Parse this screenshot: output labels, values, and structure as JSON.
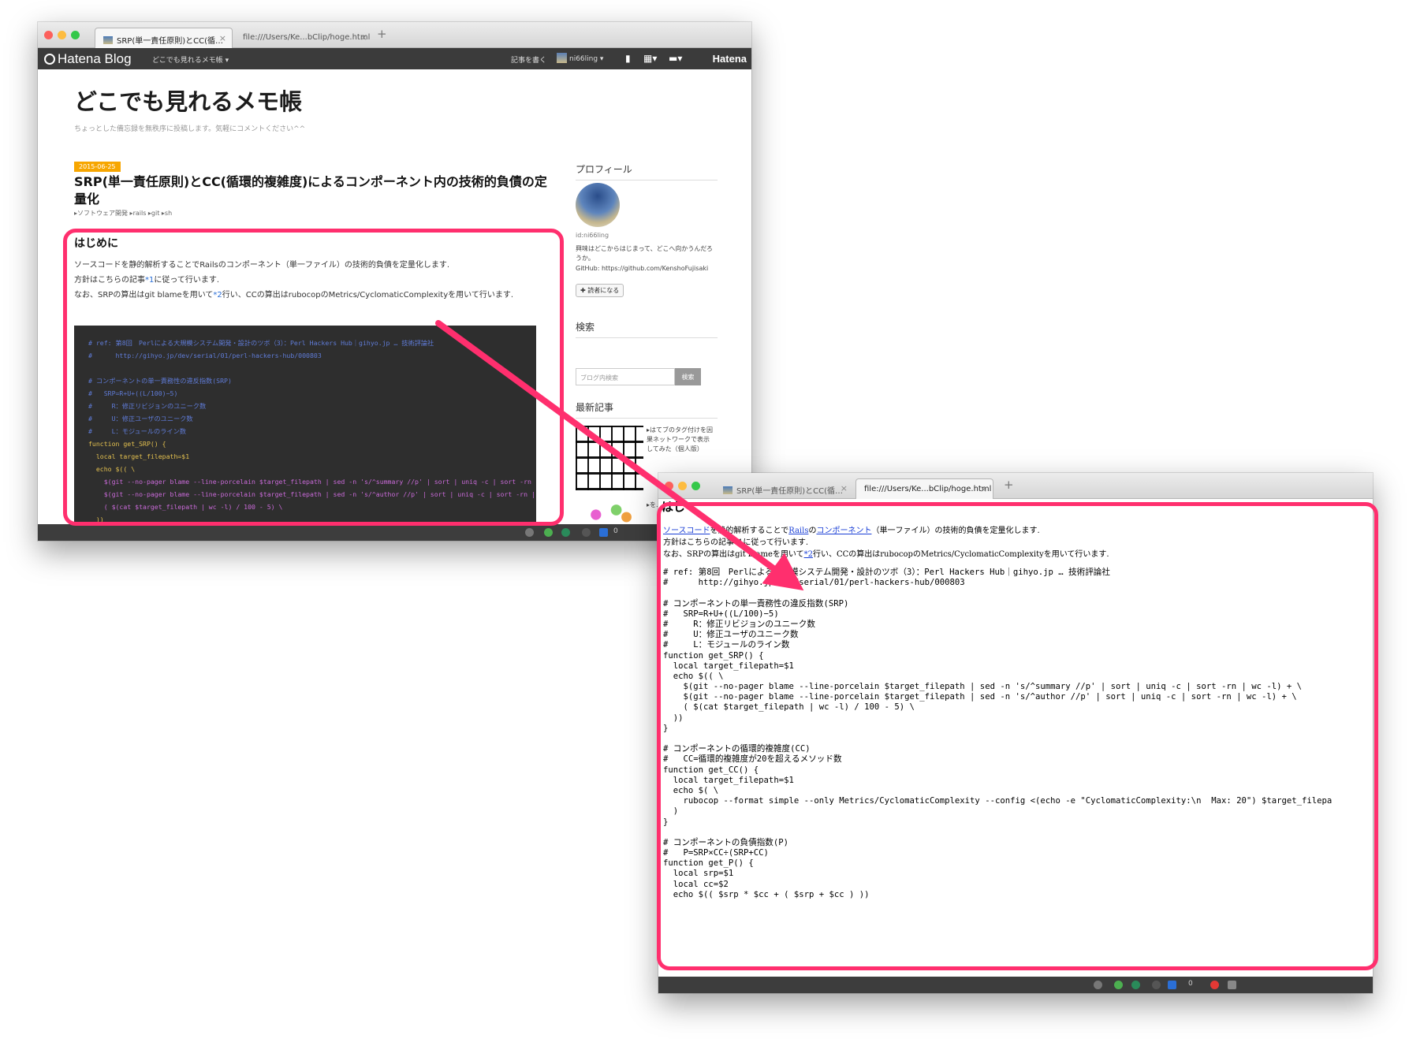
{
  "back_window": {
    "tabs": [
      {
        "label": "SRP(単一責任原則)とCC(循…",
        "active": true
      },
      {
        "label": "file:///Users/Ke...bClip/hoge.html",
        "active": false
      }
    ],
    "tab_close": "×",
    "new_tab": "+",
    "hatena_bar": {
      "logo": "Hatena Blog",
      "blog_menu": "どこでも見れるメモ帳 ▾",
      "write": "記事を書く",
      "user": "ni66ling ▾",
      "icons": [
        "bookmark-icon",
        "grid-icon",
        "comment-icon"
      ],
      "brand": "Hatena"
    },
    "blog": {
      "title": "どこでも見れるメモ帳",
      "description": "ちょっとした備忘録を無秩序に投稿します。気軽にコメントください^^",
      "date": "2015-06-25",
      "entry_title": "SRP(単一責任原則)とCC(循環的複雑度)によるコンポーネント内の技術的負債の定量化",
      "categories": "▸ソフトウェア開発 ▸rails ▸git ▸sh",
      "heading": "はじめに",
      "para1": "ソースコードを静的解析することでRailsのコンポーネント（単一ファイル）の技術的負債を定量化します.",
      "para2_a": "方針はこちらの記事",
      "para2_fn": "*1",
      "para2_b": "に従って行います.",
      "para3_a": "なお、SRPの算出はgit blameを用いて",
      "para3_fn": "*2",
      "para3_b": "行い、CCの算出はrubocopのMetrics/CyclomaticComplexityを用いて行います."
    },
    "code_lines": [
      {
        "cls": "cm",
        "text": "# ref: 第8回　Perlによる大規模システム開発・設計のツボ（3）：Perl Hackers Hub｜gihyo.jp … 技術評論社"
      },
      {
        "cls": "cm",
        "text": "#      http://gihyo.jp/dev/serial/01/perl-hackers-hub/000803"
      },
      {
        "cls": "bl",
        "text": ""
      },
      {
        "cls": "cm",
        "text": "# コンポーネントの単一責務性の違反指数(SRP)"
      },
      {
        "cls": "cm",
        "text": "#   SRP=R+U+((L/100)−5)"
      },
      {
        "cls": "cm",
        "text": "#     R：修正リビジョンのユニーク数"
      },
      {
        "cls": "cm",
        "text": "#     U：修正ユーザのユニーク数"
      },
      {
        "cls": "cm",
        "text": "#     L：モジュールのライン数"
      },
      {
        "cls": "kw",
        "text": "function get_SRP() {"
      },
      {
        "cls": "kw",
        "text": "  local target_filepath=$1"
      },
      {
        "cls": "kw",
        "text": "  echo $(( \\"
      },
      {
        "cls": "sh",
        "text": "    $(git --no-pager blame --line-porcelain $target_filepath | sed -n 's/^summary //p' | sort | uniq -c | sort -rn | wc -l) + \\"
      },
      {
        "cls": "sh",
        "text": "    $(git --no-pager blame --line-porcelain $target_filepath | sed -n 's/^author //p' | sort | uniq -c | sort -rn | wc -l) + \\"
      },
      {
        "cls": "sh",
        "text": "    ( $(cat $target_filepath | wc -l) / 100 - 5) \\"
      },
      {
        "cls": "kw",
        "text": "  ))"
      },
      {
        "cls": "kw",
        "text": "}"
      }
    ],
    "sidebar": {
      "profile_heading": "プロフィール",
      "id": "id:ni66ling",
      "bio": "興味はどこからはじまって、どこへ向かうんだろうか。",
      "github": "GitHub: https://github.com/KenshoFujisaki",
      "follow": "✚ 読者になる",
      "search_heading": "検索",
      "search_placeholder": "ブログ内検索",
      "search_button": "検索",
      "recent_heading": "最新記事",
      "recent": [
        "▸はてブのタグ付けを因果ネットワークで表示してみた（個人版）",
        "▸を...示..."
      ]
    },
    "dock_count": "0"
  },
  "front_window": {
    "tabs": [
      {
        "label": "SRP(単一責任原則)とCC(循…",
        "active": false
      },
      {
        "label": "file:///Users/Ke...bClip/hoge.html",
        "active": true
      }
    ],
    "tab_close": "×",
    "new_tab": "+",
    "heading": "はじ",
    "line1_links": [
      "ソースコード",
      "Rails",
      "コンポーネント"
    ],
    "line1_mid": "を静的解析することで",
    "line1_mid2": "の",
    "line1_end": "（単一ファイル）の技術的負債を定量化します.",
    "line2": "方針はこちらの記事*1に従って行います.",
    "line3_a": "なお、SRPの算出はgit blameを用いて",
    "line3_fn": "*2",
    "line3_b": "行い、CCの算出はrubocopのMetrics/CyclomaticComplexityを用いて行います.",
    "code_lines": [
      "# ref: 第8回　Perlによる大規模システム開発・設計のツボ（3）：Perl Hackers Hub｜gihyo.jp … 技術評論社",
      "#      http://gihyo.jp/dev/serial/01/perl-hackers-hub/000803",
      "",
      "# コンポーネントの単一責務性の違反指数(SRP)",
      "#   SRP=R+U+((L/100)−5)",
      "#     R：修正リビジョンのユニーク数",
      "#     U：修正ユーザのユニーク数",
      "#     L：モジュールのライン数",
      "function get_SRP() {",
      "  local target_filepath=$1",
      "  echo $(( \\",
      "    $(git --no-pager blame --line-porcelain $target_filepath | sed -n 's/^summary //p' | sort | uniq -c | sort -rn | wc -l) + \\",
      "    $(git --no-pager blame --line-porcelain $target_filepath | sed -n 's/^author //p' | sort | uniq -c | sort -rn | wc -l) + \\",
      "    ( $(cat $target_filepath | wc -l) / 100 - 5) \\",
      "  ))",
      "}",
      "",
      "# コンポーネントの循環的複雑度(CC)",
      "#   CC=循環的複雑度が20を超えるメソッド数",
      "function get_CC() {",
      "  local target_filepath=$1",
      "  echo $( \\",
      "    rubocop --format simple --only Metrics/CyclomaticComplexity --config <(echo -e \"CyclomaticComplexity:\\n  Max: 20\") $target_filepa",
      "  )",
      "}",
      "",
      "# コンポーネントの負債指数(P)",
      "#   P=SRP×CC÷(SRP+CC)",
      "function get_P() {",
      "  local srp=$1",
      "  local cc=$2",
      "  echo $(( $srp * $cc + ( $srp + $cc ) ))"
    ],
    "dock_count": "0"
  },
  "annotation": {
    "highlight_color": "#ff2f6e",
    "arrow_color": "#ff2f6e"
  }
}
